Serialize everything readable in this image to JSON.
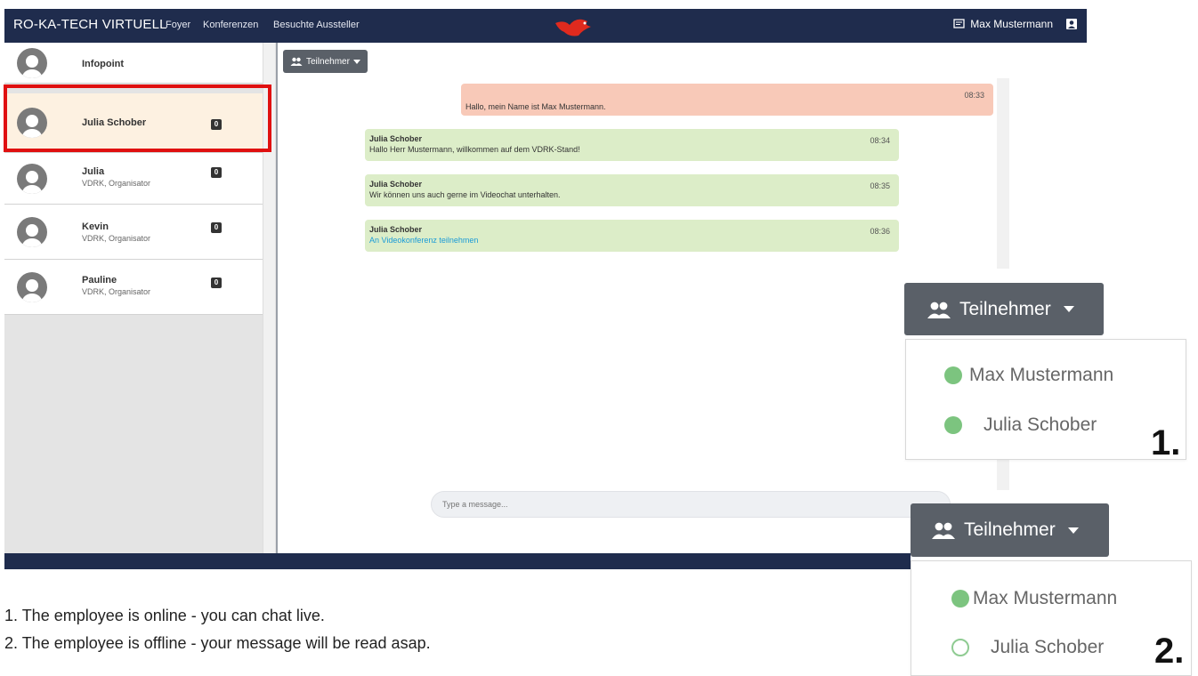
{
  "colors": {
    "navbar": "#1f2c4d",
    "active_contact": "#fdf1e1",
    "highlight": "#e01010",
    "own_message": "#f8c9b8",
    "incoming_message": "#dcedc8",
    "online": "#7cc47f",
    "link": "#1a9bd7"
  },
  "nav": {
    "brand": "RO-KA-TECH VIRTUELL",
    "links": [
      "Foyer",
      "Konferenzen",
      "Besuchte Aussteller"
    ],
    "user_name": "Max Mustermann",
    "icons": [
      "message-icon",
      "user-icon",
      "bird-logo"
    ]
  },
  "contacts": [
    {
      "name": "Infopoint",
      "subtitle": ""
    },
    {
      "name": "Julia Schober",
      "subtitle": "",
      "badge": "0"
    },
    {
      "name": "Julia",
      "subtitle": "VDRK, Organisator",
      "badge": "0"
    },
    {
      "name": "Kevin",
      "subtitle": "VDRK, Organisator",
      "badge": "0"
    },
    {
      "name": "Pauline",
      "subtitle": "VDRK, Organisator",
      "badge": "0"
    }
  ],
  "chat": {
    "participants_label": "Teilnehmer",
    "messages": [
      {
        "sender": "",
        "time": "08:33",
        "text": "Hallo, mein Name ist Max Mustermann."
      },
      {
        "sender": "Julia Schober",
        "time": "08:34",
        "text": "Hallo Herr Mustermann, willkommen auf dem VDRK-Stand!"
      },
      {
        "sender": "Julia Schober",
        "time": "08:35",
        "text": "Wir können uns auch gerne im Videochat unterhalten."
      },
      {
        "sender": "Julia Schober",
        "time": "08:36",
        "text": "An Videokonferenz teilnehmen"
      }
    ],
    "input_placeholder": "Type a message..."
  },
  "callouts": [
    {
      "button": "Teilnehmer",
      "participants": [
        {
          "name": "Max Mustermann",
          "status": "online"
        },
        {
          "name": "Julia Schober",
          "status": "online"
        }
      ],
      "number": "1."
    },
    {
      "button": "Teilnehmer",
      "participants": [
        {
          "name": "Max Mustermann",
          "status": "online"
        },
        {
          "name": "Julia Schober",
          "status": "offline"
        }
      ],
      "number": "2."
    }
  ],
  "notes": [
    "1. The employee is online - you can chat live.",
    "2. The employee is offline - your message will be read asap."
  ]
}
